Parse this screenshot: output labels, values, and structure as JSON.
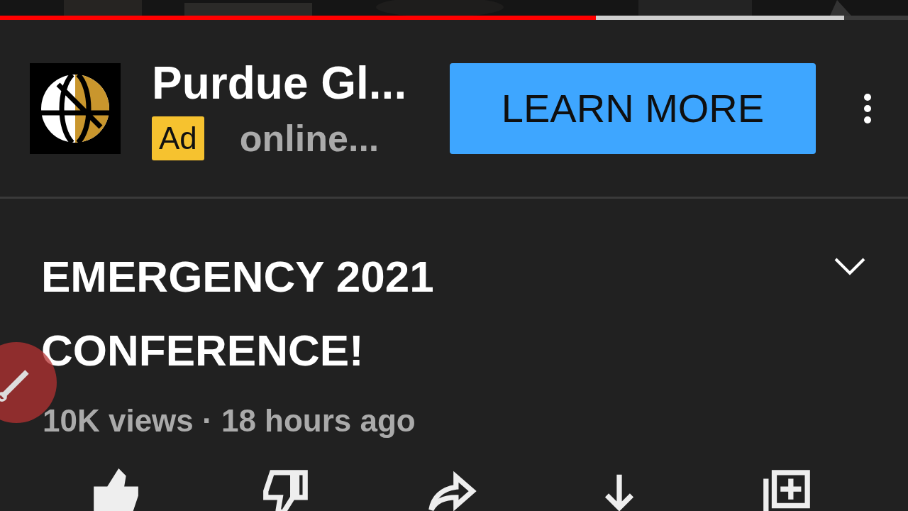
{
  "player": {
    "progress": {
      "level": 0.656
    },
    "buffer": {
      "level": 0.93
    }
  },
  "ad": {
    "advertiser": "Purdue Gl...",
    "badge": "Ad",
    "domain": "online...",
    "cta": "LEARN MORE"
  },
  "video": {
    "title": "EMERGENCY 2021 CONFERENCE!",
    "expanded": false,
    "meta": "10K views · 18 hours ago"
  },
  "actions": [
    {
      "kind": "like",
      "selected": true
    },
    {
      "kind": "dislike",
      "selected": false
    },
    {
      "kind": "share",
      "selected": false
    },
    {
      "kind": "download",
      "selected": false
    },
    {
      "kind": "save",
      "selected": false
    }
  ]
}
